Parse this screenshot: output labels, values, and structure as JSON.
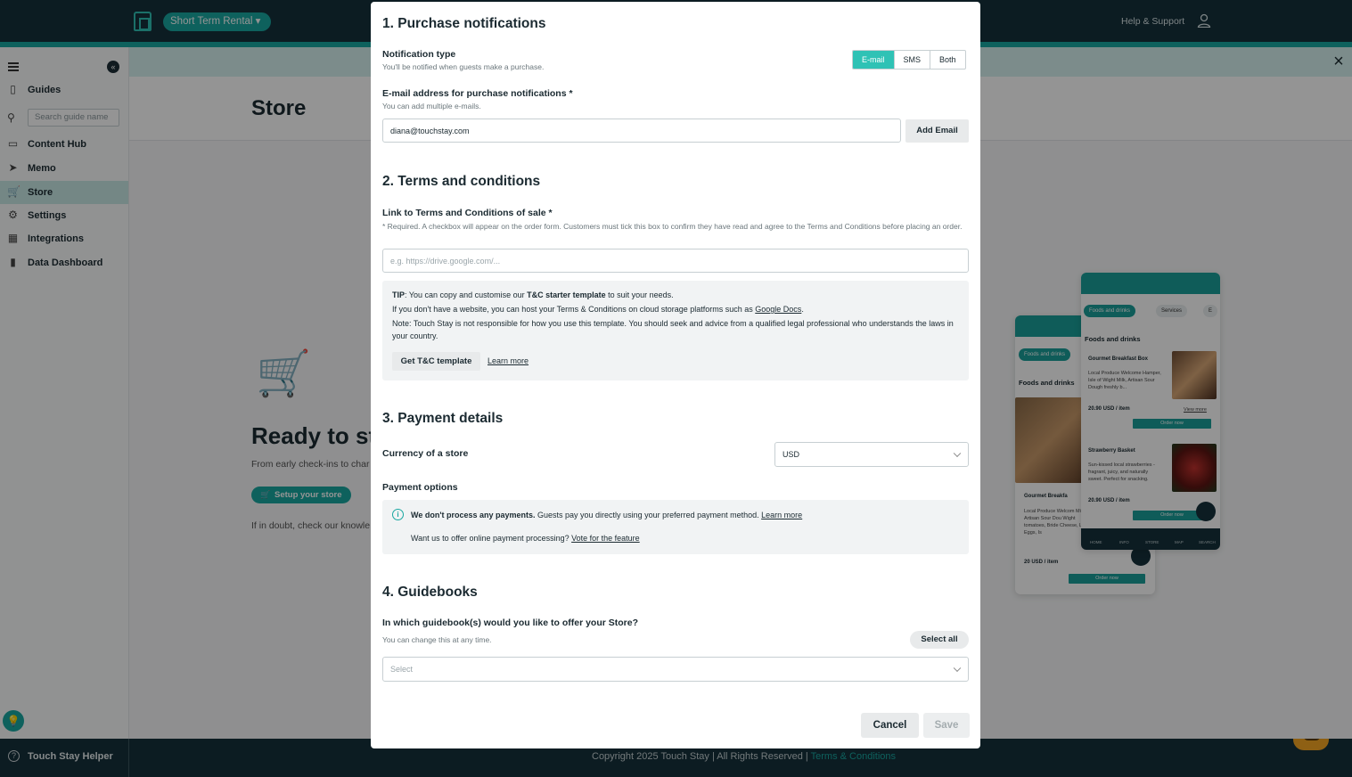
{
  "topbar": {
    "rental_selector": "Short Term Rental",
    "help_link": "Help & Support"
  },
  "sidebar": {
    "search_placeholder": "Search guide name",
    "items": [
      {
        "label": "Guides"
      },
      {
        "label": "Content Hub"
      },
      {
        "label": "Memo"
      },
      {
        "label": "Store"
      },
      {
        "label": "Settings"
      },
      {
        "label": "Integrations"
      },
      {
        "label": "Data Dashboard"
      }
    ],
    "helper_label": "Touch Stay Helper"
  },
  "page": {
    "title": "Store",
    "ready_title": "Ready to st",
    "ready_sub": "From early check-ins to char",
    "setup_button": "Setup your store",
    "doubt_text": "If in doubt, check our knowle"
  },
  "footer": {
    "copyright": "Copyright 2025 Touch Stay | All Rights Reserved |",
    "terms_link": "Terms & Conditions"
  },
  "phones": {
    "tab_foods": "Foods and drinks",
    "tab_services": "Services",
    "tab_other": "E",
    "category": "Foods and drinks",
    "card1_title": "Gourmet Breakfast Box",
    "card1_desc": "Local Produce Welcome Hamper, Isle of Wight Milk, Artisan Sour Dough freshly b...",
    "card1_price": "20.90 USD / item",
    "card2_title": "Strawberry Basket",
    "card2_desc": "Sun-kissed local strawberries - fragrant, juicy, and naturally sweet. Perfect for snacking.",
    "card2_price": "20.90 USD / item",
    "view_more": "View more",
    "order_now": "Order now",
    "qty": "1",
    "back_card_title": "Gourmet Breakfa",
    "back_card_desc": "Local Produce Welcom Milk, Artisan Sour Dou Wight tomatoes, Bride Cheese, Local Eggs, Is",
    "back_price": "20 USD / item",
    "nav": [
      "HOME",
      "INFO",
      "STORE",
      "MAP",
      "SEARCH"
    ]
  },
  "modal": {
    "section1": {
      "title": "1. Purchase notifications",
      "notif_type_label": "Notification type",
      "notif_type_hint": "You'll be notified when guests make a purchase.",
      "options": [
        "E-mail",
        "SMS",
        "Both"
      ],
      "selected": "E-mail",
      "email_label": "E-mail address for purchase notifications *",
      "email_hint": "You can add multiple e-mails.",
      "email_value": "diana@touchstay.com",
      "add_email": "Add Email"
    },
    "section2": {
      "title": "2. Terms and conditions",
      "link_label": "Link to Terms and Conditions of sale *",
      "link_hint": "* Required. A checkbox will appear on the order form. Customers must tick this box to confirm they have read and agree to the Terms and Conditions before placing an order.",
      "link_placeholder": "e.g. https://drive.google.com/...",
      "tip_prefix": "TIP",
      "tip_text_a": ": You can copy and customise our ",
      "tip_bold": "T&C starter template",
      "tip_text_b": " to suit your needs.",
      "tip_line2": "If you don't have a website, you can host your Terms & Conditions on cloud storage platforms such as ",
      "tip_line2_link": "Google Docs",
      "tip_line2_end": ".",
      "tip_line3": "Note: Touch Stay is not responsible for how you use this template. You should seek and advice from a qualified legal professional who understands the laws in your country.",
      "get_template": "Get T&C template",
      "learn_more": "Learn more"
    },
    "section3": {
      "title": "3. Payment details",
      "currency_label": "Currency of a store",
      "currency_value": "USD",
      "payment_options_label": "Payment options",
      "info_bold": "We don't process any payments.",
      "info_text": " Guests pay you directly using your preferred payment method. ",
      "info_link": "Learn more",
      "vote_text": "Want us to offer online payment processing? ",
      "vote_link": "Vote for the feature"
    },
    "section4": {
      "title": "4. Guidebooks",
      "question": "In which guidebook(s) would you like to offer your Store?",
      "hint": "You can change this at any time.",
      "select_all": "Select all",
      "select_placeholder": "Select"
    },
    "cancel": "Cancel",
    "save": "Save"
  }
}
